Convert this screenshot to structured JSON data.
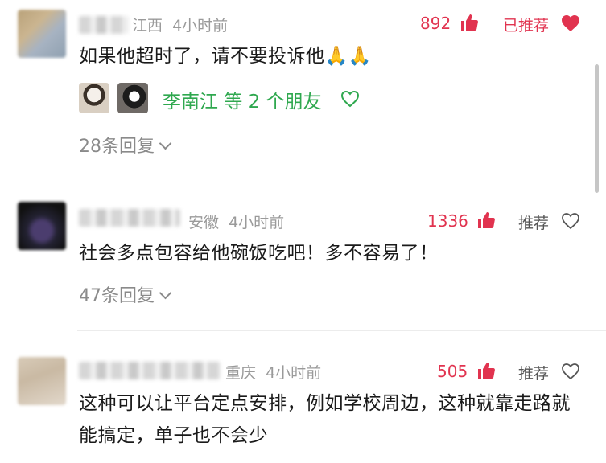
{
  "comments": [
    {
      "location": "江西",
      "time": "4小时前",
      "likes": "892",
      "recommend_label": "已推荐",
      "recommended": true,
      "text": "如果他超时了，请不要投诉他🙏🙏",
      "friends_text": "李南江 等 2 个朋友",
      "replies_label": "28条回复"
    },
    {
      "location": "安徽",
      "time": "4小时前",
      "likes": "1336",
      "recommend_label": "推荐",
      "recommended": false,
      "text": "社会多点包容给他碗饭吃吧！多不容易了！",
      "replies_label": "47条回复"
    },
    {
      "location": "重庆",
      "time": "4小时前",
      "likes": "505",
      "recommend_label": "推荐",
      "recommended": false,
      "text": "这种可以让平台定点安排，例如学校周边，这种就靠走路就能搞定，单子也不会少"
    }
  ],
  "colors": {
    "like_red": "#e1334f",
    "friend_green": "#2fa84f",
    "meta_gray": "#9a9a9a"
  },
  "icons": {
    "like": "thumbs-up-icon",
    "recommended": "heart-filled-icon",
    "not_recommended": "heart-outline-icon",
    "friend_like": "heart-outline-icon",
    "expand": "chevron-down-icon"
  }
}
